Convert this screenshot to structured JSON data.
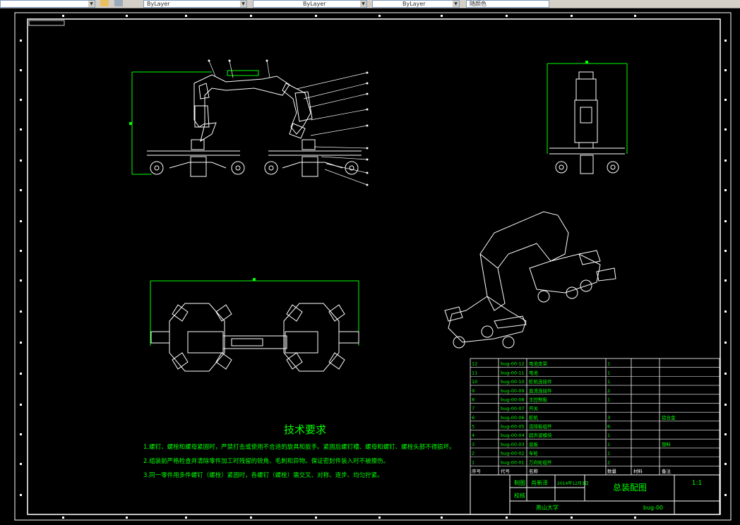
{
  "toolbar": {
    "layer_combo": "ByLayer",
    "linetype_combo": "ByLayer",
    "lineweight_combo": "ByLayer",
    "color_combo": "随颜色"
  },
  "drawing": {
    "tech_title": "技术要求",
    "tech_lines": [
      "1.螺钉、螺栓和螺母紧固时，严禁打击或使用不合适的旋具和扳手。紧固后螺钉槽、螺母和螺钉、螺栓头部不得损坏。",
      "2.组装前严格检查并清除零件加工时残留的锐角、毛刺和异物。保证密封件装入时不被擦伤。",
      "3.同一零件用多件螺钉（螺栓）紧固时，各螺钉（螺栓）需交叉、对称、逐步、均匀拧紧。"
    ],
    "bom_rows": [
      [
        "12",
        "bug-00-12",
        "电池支架",
        "1",
        "",
        ""
      ],
      [
        "11",
        "bug-00-11",
        "电池",
        "1",
        "",
        ""
      ],
      [
        "10",
        "bug-00-10",
        "舵机连接件",
        "1",
        "",
        ""
      ],
      [
        "9",
        "bug-00-09",
        "直流连接件",
        "2",
        "",
        ""
      ],
      [
        "8",
        "bug-00-08",
        "主控制板",
        "1",
        "",
        ""
      ],
      [
        "7",
        "bug-00-07",
        "开关",
        "",
        "",
        ""
      ],
      [
        "6",
        "bug-00-06",
        "舵机",
        "3",
        "",
        "铝合金"
      ],
      [
        "5",
        "bug-00-05",
        "连接板组件",
        "6",
        "",
        ""
      ],
      [
        "4",
        "bug-00-04",
        "超声波模块",
        "1",
        "",
        ""
      ],
      [
        "3",
        "bug-00-03",
        "底板",
        "1",
        "",
        "塑料"
      ],
      [
        "2",
        "bug-00-02",
        "车轮",
        "1",
        "",
        ""
      ],
      [
        "1",
        "bug-00-01",
        "万向轮组件",
        "2",
        "",
        ""
      ]
    ],
    "bom_header": [
      "序号",
      "代号",
      "名称",
      "数量",
      "材料",
      "备注"
    ],
    "title_block": {
      "draw_label": "制图",
      "draw_name": "肖新泽",
      "draw_date": "2014年12月3日",
      "check_label": "校核",
      "drawing_name": "总装配图",
      "scale": "1:1",
      "school": "燕山大学",
      "code": "bug-00"
    }
  }
}
